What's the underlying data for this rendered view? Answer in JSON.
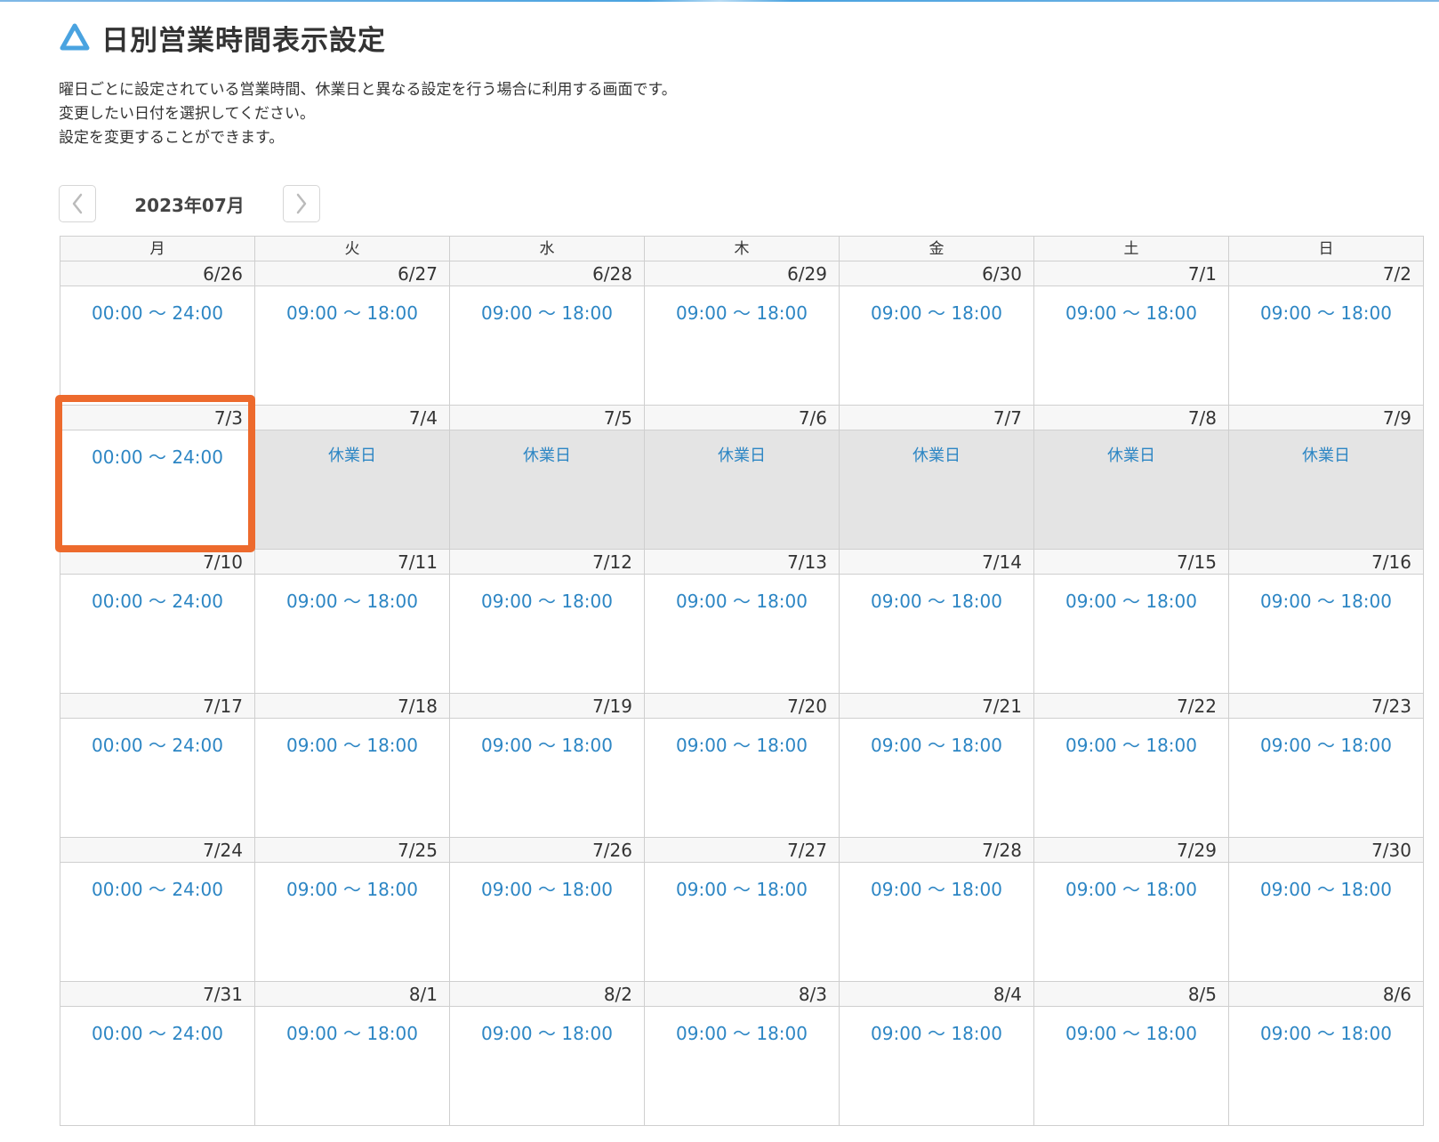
{
  "page": {
    "title": "日別営業時間表示設定",
    "description": [
      "曜日ごとに設定されている営業時間、休業日と異なる設定を行う場合に利用する画面です。",
      "変更したい日付を選択してください。",
      "設定を変更することができます。"
    ],
    "accent_color": "#4aa3e0",
    "highlight_color": "#ed6a2d"
  },
  "month_nav": {
    "label": "2023年07月",
    "prev_icon": "chevron-left-icon",
    "next_icon": "chevron-right-icon"
  },
  "calendar": {
    "weekdays": [
      "月",
      "火",
      "水",
      "木",
      "金",
      "土",
      "日"
    ],
    "weeks": [
      {
        "dates": [
          "6/26",
          "6/27",
          "6/28",
          "6/29",
          "6/30",
          "7/1",
          "7/2"
        ],
        "entries": [
          "00:00 〜 24:00",
          "09:00 〜 18:00",
          "09:00 〜 18:00",
          "09:00 〜 18:00",
          "09:00 〜 18:00",
          "09:00 〜 18:00",
          "09:00 〜 18:00"
        ],
        "closed": [
          false,
          false,
          false,
          false,
          false,
          false,
          false
        ]
      },
      {
        "dates": [
          "7/3",
          "7/4",
          "7/5",
          "7/6",
          "7/7",
          "7/8",
          "7/9"
        ],
        "entries": [
          "00:00 〜 24:00",
          "休業日",
          "休業日",
          "休業日",
          "休業日",
          "休業日",
          "休業日"
        ],
        "closed": [
          false,
          true,
          true,
          true,
          true,
          true,
          true
        ]
      },
      {
        "dates": [
          "7/10",
          "7/11",
          "7/12",
          "7/13",
          "7/14",
          "7/15",
          "7/16"
        ],
        "entries": [
          "00:00 〜 24:00",
          "09:00 〜 18:00",
          "09:00 〜 18:00",
          "09:00 〜 18:00",
          "09:00 〜 18:00",
          "09:00 〜 18:00",
          "09:00 〜 18:00"
        ],
        "closed": [
          false,
          false,
          false,
          false,
          false,
          false,
          false
        ]
      },
      {
        "dates": [
          "7/17",
          "7/18",
          "7/19",
          "7/20",
          "7/21",
          "7/22",
          "7/23"
        ],
        "entries": [
          "00:00 〜 24:00",
          "09:00 〜 18:00",
          "09:00 〜 18:00",
          "09:00 〜 18:00",
          "09:00 〜 18:00",
          "09:00 〜 18:00",
          "09:00 〜 18:00"
        ],
        "closed": [
          false,
          false,
          false,
          false,
          false,
          false,
          false
        ]
      },
      {
        "dates": [
          "7/24",
          "7/25",
          "7/26",
          "7/27",
          "7/28",
          "7/29",
          "7/30"
        ],
        "entries": [
          "00:00 〜 24:00",
          "09:00 〜 18:00",
          "09:00 〜 18:00",
          "09:00 〜 18:00",
          "09:00 〜 18:00",
          "09:00 〜 18:00",
          "09:00 〜 18:00"
        ],
        "closed": [
          false,
          false,
          false,
          false,
          false,
          false,
          false
        ]
      },
      {
        "dates": [
          "7/31",
          "8/1",
          "8/2",
          "8/3",
          "8/4",
          "8/5",
          "8/6"
        ],
        "entries": [
          "00:00 〜 24:00",
          "09:00 〜 18:00",
          "09:00 〜 18:00",
          "09:00 〜 18:00",
          "09:00 〜 18:00",
          "09:00 〜 18:00",
          "09:00 〜 18:00"
        ],
        "closed": [
          false,
          false,
          false,
          false,
          false,
          false,
          false
        ]
      }
    ],
    "selected": "7/3"
  }
}
